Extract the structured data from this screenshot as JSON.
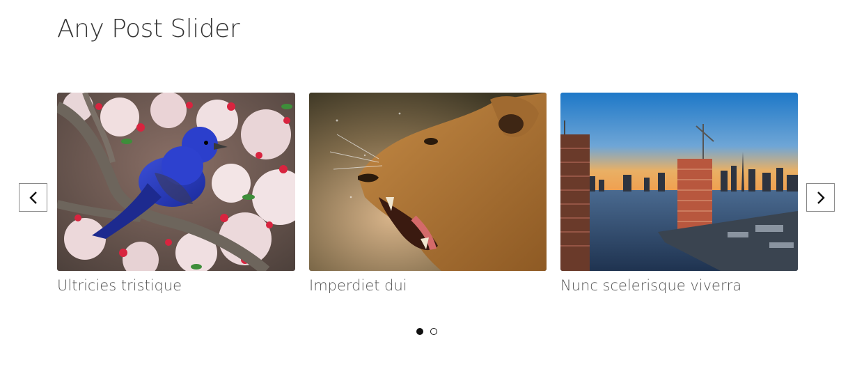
{
  "slider": {
    "title": "Any Post Slider",
    "prev_icon": "chevron-left-icon",
    "next_icon": "chevron-right-icon",
    "slides": [
      {
        "caption": "Ultricies tristique",
        "image": "blue-bird-on-blossom-branch"
      },
      {
        "caption": "Imperdiet dui",
        "image": "roaring-lioness"
      },
      {
        "caption": "Nunc scelerisque viverra",
        "image": "city-skyline-at-sunset"
      }
    ],
    "dots": {
      "count": 2,
      "active": 1
    }
  },
  "colors": {
    "text": "#333333",
    "caption": "#555555",
    "border": "#8a8a8a",
    "dot": "#111111"
  }
}
